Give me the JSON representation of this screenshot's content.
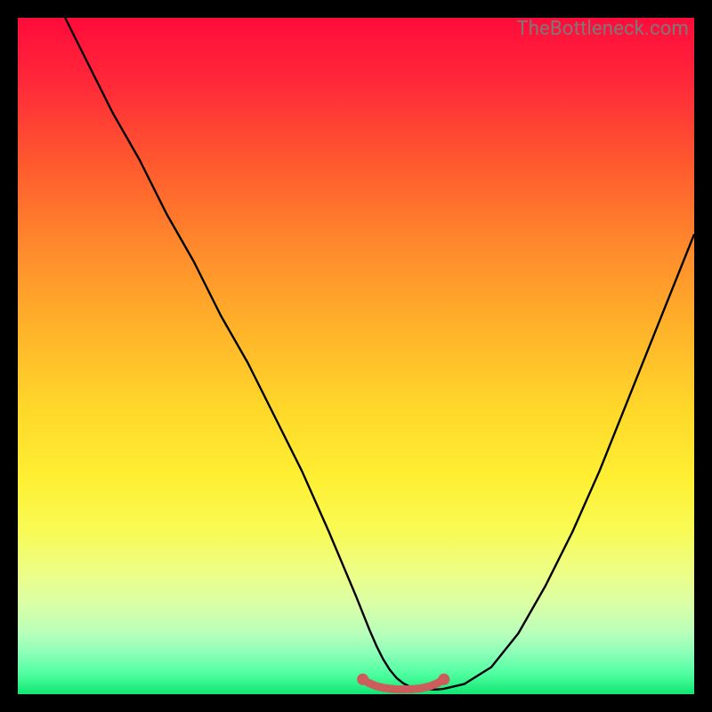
{
  "watermark": "TheBottleneck.com",
  "chart_data": {
    "type": "line",
    "title": "",
    "xlabel": "",
    "ylabel": "",
    "xlim": [
      0,
      100
    ],
    "ylim": [
      0,
      100
    ],
    "grid": false,
    "series": [
      {
        "name": "curve",
        "color": "#000000",
        "x": [
          7,
          10,
          14,
          18,
          22,
          26,
          30,
          34,
          38,
          42,
          46,
          50,
          51,
          52,
          53,
          54,
          55,
          56,
          57,
          58,
          59,
          60,
          61,
          62,
          63,
          66,
          70,
          74,
          78,
          82,
          86,
          90,
          94,
          98,
          100
        ],
        "y": [
          100,
          94,
          86,
          79,
          71,
          64,
          56,
          49,
          41,
          33,
          24,
          14.5,
          12,
          9.5,
          7.2,
          5.2,
          3.6,
          2.4,
          1.6,
          1.1,
          0.8,
          0.7,
          0.7,
          0.7,
          0.8,
          1.5,
          4,
          9,
          16,
          24,
          33,
          43,
          53,
          63,
          68
        ]
      },
      {
        "name": "floor-marker",
        "color": "#cd5c5c",
        "x": [
          51,
          52,
          53,
          54,
          55,
          56,
          57,
          58,
          59,
          60,
          61,
          62,
          63
        ],
        "y": [
          2.2,
          1.6,
          1.2,
          0.95,
          0.8,
          0.72,
          0.7,
          0.72,
          0.8,
          0.95,
          1.2,
          1.6,
          2.2
        ]
      }
    ],
    "annotations": []
  }
}
